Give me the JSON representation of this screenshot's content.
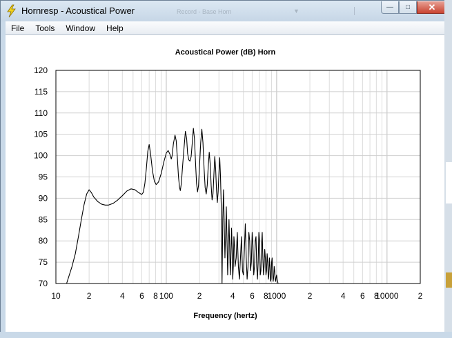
{
  "window": {
    "title": "Hornresp - Acoustical Power",
    "ghost_text": "Record - Base Horn",
    "caption_buttons": {
      "minimize": "—",
      "maximize": "□",
      "close": "✕"
    }
  },
  "menu": [
    "File",
    "Tools",
    "Window",
    "Help"
  ],
  "chart_data": {
    "type": "line",
    "title": "Acoustical Power (dB)   Horn",
    "xlabel": "Frequency (hertz)",
    "ylabel": "",
    "x_scale": "log",
    "xlim": [
      10,
      20000
    ],
    "ylim": [
      70,
      120
    ],
    "grid": true,
    "y_ticks": [
      "70",
      "75",
      "80",
      "85",
      "90",
      "95",
      "100",
      "105",
      "110",
      "115",
      "120"
    ],
    "x_tick_labels": [
      {
        "f": 10,
        "label": "10"
      },
      {
        "f": 20,
        "label": "2"
      },
      {
        "f": 40,
        "label": "4"
      },
      {
        "f": 60,
        "label": "6"
      },
      {
        "f": 80,
        "label": "8"
      },
      {
        "f": 100,
        "label": "100"
      },
      {
        "f": 200,
        "label": "2"
      },
      {
        "f": 400,
        "label": "4"
      },
      {
        "f": 600,
        "label": "6"
      },
      {
        "f": 800,
        "label": "8"
      },
      {
        "f": 1000,
        "label": "1000"
      },
      {
        "f": 2000,
        "label": "2"
      },
      {
        "f": 4000,
        "label": "4"
      },
      {
        "f": 6000,
        "label": "6"
      },
      {
        "f": 8000,
        "label": "8"
      },
      {
        "f": 10000,
        "label": "10000"
      },
      {
        "f": 20000,
        "label": "2"
      }
    ],
    "series": [
      {
        "color": "#000000",
        "points": [
          [
            12.5,
            70
          ],
          [
            14,
            74
          ],
          [
            15,
            77
          ],
          [
            16,
            81
          ],
          [
            17,
            85
          ],
          [
            18,
            88.5
          ],
          [
            19,
            91
          ],
          [
            20,
            92
          ],
          [
            21,
            91.3
          ],
          [
            22,
            90.3
          ],
          [
            24,
            89.2
          ],
          [
            26,
            88.6
          ],
          [
            28,
            88.4
          ],
          [
            30,
            88.4
          ],
          [
            33,
            88.8
          ],
          [
            36,
            89.5
          ],
          [
            40,
            90.6
          ],
          [
            44,
            91.7
          ],
          [
            48,
            92.2
          ],
          [
            52,
            92
          ],
          [
            55,
            91.5
          ],
          [
            58,
            91.1
          ],
          [
            60,
            90.9
          ],
          [
            62,
            91.4
          ],
          [
            64,
            93.5
          ],
          [
            66,
            97
          ],
          [
            68,
            101
          ],
          [
            70,
            102.6
          ],
          [
            72,
            100.5
          ],
          [
            75,
            96.4
          ],
          [
            78,
            94
          ],
          [
            81,
            93.2
          ],
          [
            85,
            93.8
          ],
          [
            90,
            95.8
          ],
          [
            95,
            98.5
          ],
          [
            100,
            100.6
          ],
          [
            104,
            101.2
          ],
          [
            108,
            100.3
          ],
          [
            111,
            99.2
          ],
          [
            113,
            100
          ],
          [
            116,
            102.8
          ],
          [
            120,
            104.8
          ],
          [
            123,
            103.5
          ],
          [
            126,
            99.5
          ],
          [
            129,
            95
          ],
          [
            132,
            92.5
          ],
          [
            134,
            91.8
          ],
          [
            137,
            93.5
          ],
          [
            140,
            97
          ],
          [
            145,
            102
          ],
          [
            149,
            105.7
          ],
          [
            153,
            104
          ],
          [
            156,
            100.5
          ],
          [
            160,
            99
          ],
          [
            164,
            98.7
          ],
          [
            168,
            99.8
          ],
          [
            172,
            103
          ],
          [
            176,
            106.4
          ],
          [
            180,
            104
          ],
          [
            184,
            98.5
          ],
          [
            188,
            93.5
          ],
          [
            192,
            91.5
          ],
          [
            196,
            93
          ],
          [
            200,
            97.5
          ],
          [
            205,
            103
          ],
          [
            210,
            106.2
          ],
          [
            215,
            103
          ],
          [
            220,
            97
          ],
          [
            225,
            92.5
          ],
          [
            230,
            91
          ],
          [
            235,
            93
          ],
          [
            240,
            97.5
          ],
          [
            245,
            100.8
          ],
          [
            250,
            98
          ],
          [
            255,
            93
          ],
          [
            260,
            89.6
          ],
          [
            265,
            91
          ],
          [
            270,
            95.5
          ],
          [
            275,
            99.8
          ],
          [
            280,
            97
          ],
          [
            285,
            92
          ],
          [
            290,
            89
          ],
          [
            295,
            91.5
          ],
          [
            300,
            96
          ],
          [
            305,
            99.5
          ],
          [
            310,
            95
          ],
          [
            315,
            88
          ],
          [
            320,
            70
          ],
          [
            325,
            85
          ],
          [
            330,
            92
          ],
          [
            335,
            84
          ],
          [
            340,
            76
          ],
          [
            345,
            82
          ],
          [
            350,
            88
          ],
          [
            355,
            80
          ],
          [
            360,
            72
          ],
          [
            365,
            78
          ],
          [
            370,
            85
          ],
          [
            375,
            79
          ],
          [
            380,
            72
          ],
          [
            385,
            76
          ],
          [
            390,
            83
          ],
          [
            395,
            78
          ],
          [
            400,
            71
          ],
          [
            405,
            74
          ],
          [
            410,
            81
          ],
          [
            415,
            79
          ],
          [
            420,
            74
          ],
          [
            430,
            76
          ],
          [
            440,
            82
          ],
          [
            450,
            74
          ],
          [
            460,
            71
          ],
          [
            470,
            76
          ],
          [
            480,
            81
          ],
          [
            490,
            73
          ],
          [
            500,
            72
          ],
          [
            510,
            78
          ],
          [
            520,
            84
          ],
          [
            530,
            76
          ],
          [
            540,
            71
          ],
          [
            550,
            74
          ],
          [
            560,
            82
          ],
          [
            570,
            80
          ],
          [
            580,
            73
          ],
          [
            590,
            75
          ],
          [
            600,
            82
          ],
          [
            610,
            79
          ],
          [
            620,
            72
          ],
          [
            630,
            74
          ],
          [
            640,
            80
          ],
          [
            650,
            81
          ],
          [
            660,
            74
          ],
          [
            670,
            71
          ],
          [
            680,
            75
          ],
          [
            690,
            82
          ],
          [
            700,
            80
          ],
          [
            710,
            72
          ],
          [
            720,
            73
          ],
          [
            730,
            79
          ],
          [
            740,
            82
          ],
          [
            750,
            76
          ],
          [
            760,
            72
          ],
          [
            770,
            74
          ],
          [
            780,
            78
          ],
          [
            790,
            76
          ],
          [
            800,
            72
          ],
          [
            810,
            73
          ],
          [
            820,
            77
          ],
          [
            830,
            75
          ],
          [
            840,
            71
          ],
          [
            850,
            72
          ],
          [
            860,
            76
          ],
          [
            870,
            74
          ],
          [
            880,
            70.5
          ],
          [
            890,
            71
          ],
          [
            900,
            75
          ],
          [
            910,
            76
          ],
          [
            920,
            72
          ],
          [
            930,
            70.5
          ],
          [
            940,
            71.5
          ],
          [
            950,
            74
          ],
          [
            960,
            73
          ],
          [
            970,
            71
          ],
          [
            980,
            70.5
          ],
          [
            990,
            71.5
          ],
          [
            1000,
            72
          ],
          [
            1010,
            71
          ],
          [
            1020,
            70.5
          ],
          [
            1030,
            70
          ]
        ]
      }
    ]
  }
}
